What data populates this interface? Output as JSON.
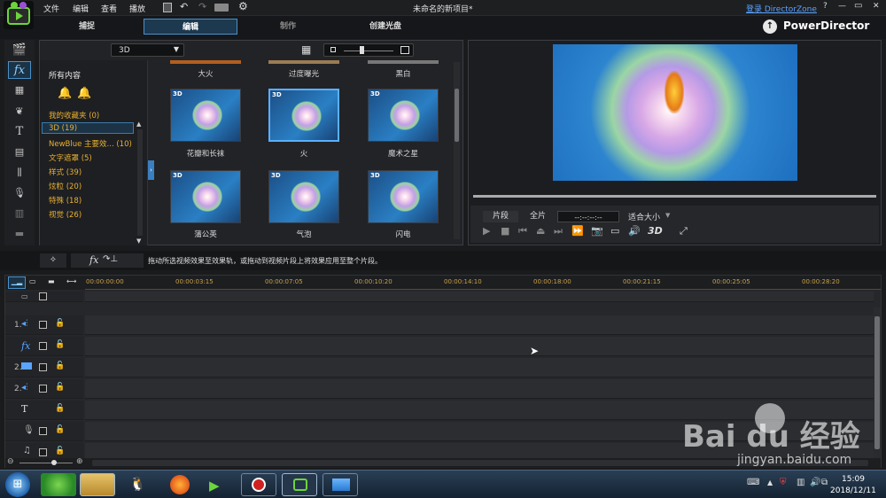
{
  "menu": {
    "items": [
      "文件",
      "编辑",
      "查看",
      "播放"
    ],
    "project_title": "未命名的新项目*",
    "login_link": "登录 DirectorZone",
    "help": "?",
    "minimize": "—",
    "restore": "▭",
    "close": "✕"
  },
  "modes": {
    "capture": "捕捉",
    "edit": "编辑",
    "produce": "制作",
    "disc": "创建光盘"
  },
  "brand": "PowerDirector",
  "library": {
    "dropdown_value": "3D",
    "all_content": "所有内容",
    "categories": [
      "我的收藏夹  (0)",
      "3D  (19)",
      "NewBlue 主要效...  (10)",
      "文字遮罩  (5)",
      "样式  (39)",
      "炫粒  (20)",
      "特殊  (18)",
      "视觉  (26)"
    ],
    "top_labels": [
      "大火",
      "过度曝光",
      "黑白"
    ],
    "thumbnails": [
      {
        "tag": "3D",
        "label": "花瓣和长袜"
      },
      {
        "tag": "3D",
        "label": "火"
      },
      {
        "tag": "3D",
        "label": "魔术之星"
      },
      {
        "tag": "3D",
        "label": "蒲公英"
      },
      {
        "tag": "3D",
        "label": "气泡"
      },
      {
        "tag": "3D",
        "label": "闪电"
      }
    ]
  },
  "preview": {
    "clip_button": "片段",
    "full_button": "全片",
    "timecode": "--:--:--:--",
    "fit_dropdown": "适合大小",
    "mode_3d": "3D"
  },
  "fx_hint": "拖动所选视频效果至效果轨，或拖动到视频片段上将效果应用至整个片段。",
  "fx_label": "fx",
  "ruler": [
    "00:00:00:00",
    "00:00:03:15",
    "00:00:07:05",
    "00:00:10:20",
    "00:00:14:10",
    "00:00:18:00",
    "00:00:21:15",
    "00:00:25:05",
    "00:00:28:20"
  ],
  "track_labels": {
    "t1": "1.",
    "t2": "fx",
    "t3": "2.",
    "t4": "2.",
    "t5": "T"
  },
  "taskbar": {
    "time": "15:09",
    "date": "2018/12/11"
  },
  "watermark": {
    "brand": "Bai  du 经验",
    "url": "jingyan.baidu.com"
  }
}
